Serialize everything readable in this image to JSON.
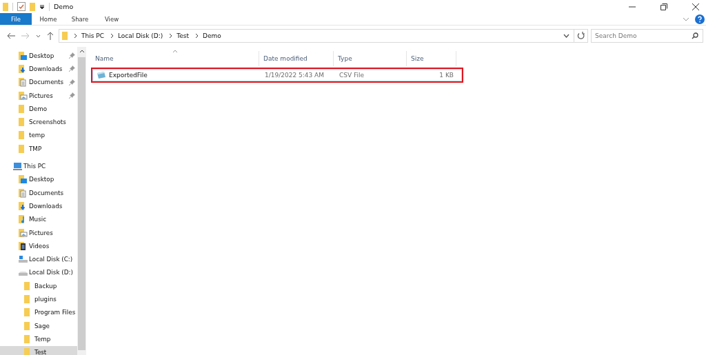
{
  "window": {
    "title": "Demo"
  },
  "ribbon_tabs": [
    {
      "label": "File",
      "selected": true
    },
    {
      "label": "Home",
      "selected": false
    },
    {
      "label": "Share",
      "selected": false
    },
    {
      "label": "View",
      "selected": false
    }
  ],
  "address": {
    "path": [
      "This PC",
      "Local Disk (D:)",
      "Test",
      "Demo"
    ]
  },
  "search": {
    "placeholder": "Search Demo"
  },
  "sidebar": {
    "items": [
      {
        "label": "Desktop",
        "kind": "desktop",
        "pinned": true,
        "selected": false
      },
      {
        "label": "Downloads",
        "kind": "downloads",
        "pinned": true,
        "selected": false
      },
      {
        "label": "Documents",
        "kind": "documents",
        "pinned": true,
        "selected": false
      },
      {
        "label": "Pictures",
        "kind": "pictures",
        "pinned": true,
        "selected": false
      },
      {
        "label": "Demo",
        "kind": "folder",
        "pinned": false,
        "selected": false
      },
      {
        "label": "Screenshots",
        "kind": "folder",
        "pinned": false,
        "selected": false
      },
      {
        "label": "temp",
        "kind": "folder",
        "pinned": false,
        "selected": false
      },
      {
        "label": "TMP",
        "kind": "folder",
        "pinned": false,
        "selected": false
      },
      {
        "label": "This PC",
        "kind": "pc",
        "pinned": false,
        "selected": false,
        "children": [
          {
            "label": "Desktop",
            "kind": "desktop",
            "pinned": false,
            "selected": false
          },
          {
            "label": "Documents",
            "kind": "documents",
            "pinned": false,
            "selected": false
          },
          {
            "label": "Downloads",
            "kind": "downloads",
            "pinned": false,
            "selected": false
          },
          {
            "label": "Music",
            "kind": "music",
            "pinned": false,
            "selected": false
          },
          {
            "label": "Pictures",
            "kind": "pictures",
            "pinned": false,
            "selected": false
          },
          {
            "label": "Videos",
            "kind": "videos",
            "pinned": false,
            "selected": false
          },
          {
            "label": "Local Disk (C:)",
            "kind": "system-drive",
            "pinned": false,
            "selected": false
          },
          {
            "label": "Local Disk (D:)",
            "kind": "drive",
            "pinned": false,
            "selected": false,
            "children": [
              {
                "label": "Backup",
                "kind": "folder",
                "pinned": false,
                "selected": false
              },
              {
                "label": "plugins",
                "kind": "folder",
                "pinned": false,
                "selected": false
              },
              {
                "label": "Program Files",
                "kind": "folder",
                "pinned": false,
                "selected": false
              },
              {
                "label": "Sage",
                "kind": "folder",
                "pinned": false,
                "selected": false
              },
              {
                "label": "Temp",
                "kind": "folder",
                "pinned": false,
                "selected": false
              },
              {
                "label": "Test",
                "kind": "folder",
                "pinned": false,
                "selected": true
              }
            ]
          }
        ]
      }
    ]
  },
  "table": {
    "columns": [
      "Name",
      "Date modified",
      "Type",
      "Size"
    ],
    "rows": [
      {
        "name": "ExportedFile",
        "date": "1/19/2022 5:43 AM",
        "type": "CSV File",
        "size": "1 KB",
        "highlighted": true
      }
    ]
  }
}
